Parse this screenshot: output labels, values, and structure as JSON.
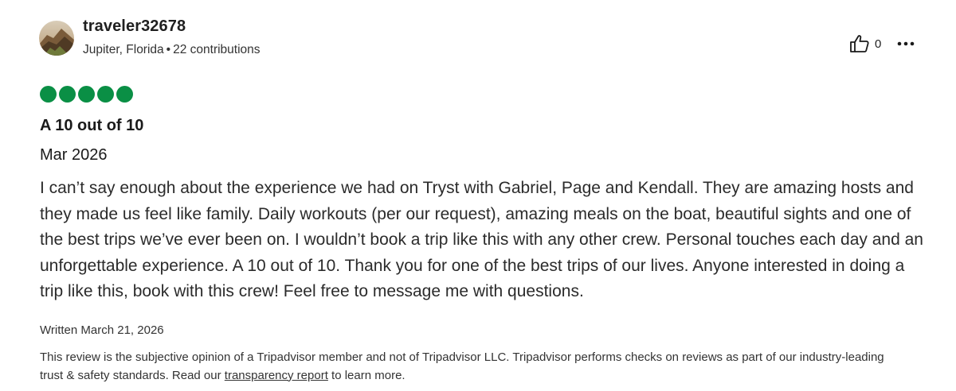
{
  "reviewer": {
    "username": "traveler32678",
    "location": "Jupiter, Florida",
    "separator": "•",
    "contributions": "22 contributions",
    "avatar_icon": "user-avatar-photo"
  },
  "actions": {
    "helpful_count": "0",
    "helpful_icon": "thumbs-up-icon",
    "more_icon": "more-options-icon"
  },
  "rating": {
    "value": 5,
    "max": 5,
    "color": "#0a8f45"
  },
  "review": {
    "title": "A 10 out of 10",
    "date": "Mar 2026",
    "body": "I can’t say enough about the experience we had on Tryst with Gabriel, Page and Kendall. They are amazing hosts and they made us feel like family. Daily workouts (per our request), amazing meals on the boat, beautiful sights and one of the best trips we’ve ever been on. I wouldn’t book a trip like this with any other crew. Personal touches each day and an unforgettable experience. A 10 out of 10. Thank you for one of the best trips of our lives. Anyone interested in doing a trip like this, book with this crew! Feel free to message me with questions.",
    "written": "Written March 21, 2026"
  },
  "disclaimer": {
    "text_before": "This review is the subjective opinion of a Tripadvisor member and not of Tripadvisor LLC. Tripadvisor performs checks on reviews as part of our industry-leading trust & safety standards. Read our ",
    "link_text": "transparency report",
    "text_after": " to learn more."
  }
}
